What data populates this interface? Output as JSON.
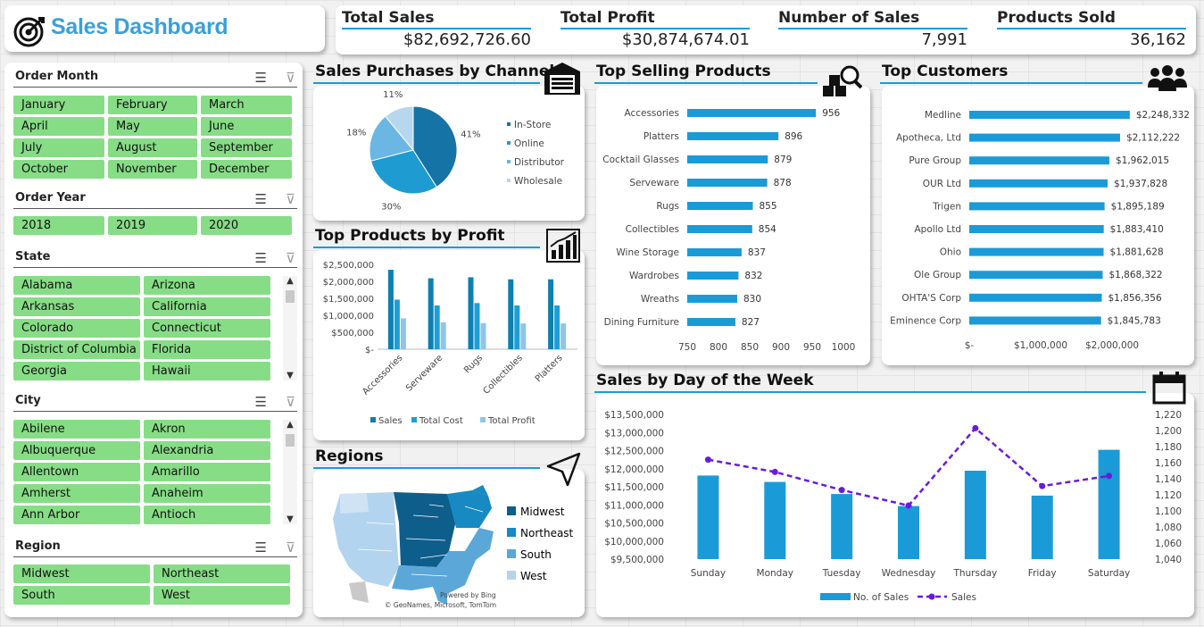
{
  "title": "Sales Dashboard",
  "kpis": [
    {
      "label": "Total Sales",
      "value": "$82,692,726.60"
    },
    {
      "label": "Total Profit",
      "value": "$30,874,674.01"
    },
    {
      "label": "Number of Sales",
      "value": "7,991"
    },
    {
      "label": "Products Sold",
      "value": "36,162"
    }
  ],
  "slicers": {
    "order_month": {
      "title": "Order Month",
      "items": [
        "January",
        "February",
        "March",
        "April",
        "May",
        "June",
        "July",
        "August",
        "September",
        "October",
        "November",
        "December"
      ]
    },
    "order_year": {
      "title": "Order Year",
      "items": [
        "2018",
        "2019",
        "2020"
      ]
    },
    "state": {
      "title": "State",
      "items": [
        "Alabama",
        "Arizona",
        "Arkansas",
        "California",
        "Colorado",
        "Connecticut",
        "District of Columbia",
        "Florida",
        "Georgia",
        "Hawaii"
      ]
    },
    "city": {
      "title": "City",
      "items": [
        "Abilene",
        "Akron",
        "Albuquerque",
        "Alexandria",
        "Allentown",
        "Amarillo",
        "Amherst",
        "Anaheim",
        "Ann Arbor",
        "Antioch"
      ]
    },
    "region": {
      "title": "Region",
      "items": [
        "Midwest",
        "Northeast",
        "South",
        "West"
      ]
    }
  },
  "panels": {
    "channel": "Sales Purchases by Channel",
    "products_profit": "Top Products by Profit",
    "regions": "Regions",
    "top_products": "Top Selling Products",
    "top_customers": "Top Customers",
    "day_of_week": "Sales by Day of the Week"
  },
  "map": {
    "legend": [
      "Midwest",
      "Northeast",
      "South",
      "West"
    ],
    "colors": [
      "#0e5e8c",
      "#1789c3",
      "#5aa7d8",
      "#b3d4ee"
    ],
    "credit1": "Powered by Bing",
    "credit2": "© GeoNames, Microsoft, TomTom"
  },
  "colors": {
    "accent": "#1a9bd7",
    "slicer_button": "#86dd86",
    "title": "#3aa0db"
  },
  "chart_data": [
    {
      "id": "channel",
      "type": "pie",
      "labels": [
        "In-Store",
        "Online",
        "Distributor",
        "Wholesale"
      ],
      "values": [
        41,
        30,
        18,
        11
      ],
      "value_labels": [
        "41%",
        "30%",
        "18%",
        "11%"
      ],
      "colors": [
        "#1673a6",
        "#1e9bd1",
        "#6bb6e2",
        "#b7d7ef"
      ],
      "legend_position": "right"
    },
    {
      "id": "products_profit",
      "type": "bar",
      "categories": [
        "Accessories",
        "Serveware",
        "Rugs",
        "Collectibles",
        "Platters"
      ],
      "series": [
        {
          "name": "Sales",
          "values": [
            2340000,
            2090000,
            2120000,
            2060000,
            2060000
          ],
          "color": "#0e7fae"
        },
        {
          "name": "Total Cost",
          "values": [
            1460000,
            1290000,
            1360000,
            1290000,
            1290000
          ],
          "color": "#1a9fd8"
        },
        {
          "name": "Total Profit",
          "values": [
            910000,
            790000,
            770000,
            760000,
            760000
          ],
          "color": "#8ec5ea"
        }
      ],
      "yticks": [
        "$-",
        "$500,000",
        "$1,000,000",
        "$1,500,000",
        "$2,000,000",
        "$2,500,000"
      ],
      "ylim": [
        0,
        2500000
      ],
      "legend_position": "bottom"
    },
    {
      "id": "top_products",
      "type": "bar",
      "orientation": "horizontal",
      "categories": [
        "Accessories",
        "Platters",
        "Cocktail Glasses",
        "Serveware",
        "Rugs",
        "Collectibles",
        "Wine Storage",
        "Wardrobes",
        "Wreaths",
        "Dining Furniture"
      ],
      "values": [
        956,
        896,
        879,
        878,
        855,
        854,
        837,
        832,
        830,
        827
      ],
      "xticks": [
        "750",
        "800",
        "850",
        "900",
        "950",
        "1000"
      ],
      "xlim": [
        750,
        1000
      ],
      "color": "#1a9bd7"
    },
    {
      "id": "top_customers",
      "type": "bar",
      "orientation": "horizontal",
      "categories": [
        "Medline",
        "Apotheca, Ltd",
        "Pure Group",
        "OUR Ltd",
        "Trigen",
        "Apollo Ltd",
        "Ohio",
        "Ole Group",
        "OHTA'S Corp",
        "Eminence Corp"
      ],
      "values": [
        2248332,
        2112222,
        1962015,
        1937828,
        1895189,
        1883410,
        1881628,
        1868322,
        1856356,
        1845783
      ],
      "value_labels": [
        "$2,248,332",
        "$2,112,222",
        "$1,962,015",
        "$1,937,828",
        "$1,895,189",
        "$1,883,410",
        "$1,881,628",
        "$1,868,322",
        "$1,856,356",
        "$1,845,783"
      ],
      "xticks": [
        "$-",
        "$1,000,000",
        "$2,000,000"
      ],
      "xlim": [
        0,
        2500000
      ],
      "color": "#1a9bd7"
    },
    {
      "id": "day_of_week",
      "type": "bar",
      "categories": [
        "Sunday",
        "Monday",
        "Tuesday",
        "Wednesday",
        "Thursday",
        "Friday",
        "Saturday"
      ],
      "series": [
        {
          "name": "No. of Sales",
          "type": "bar",
          "values": [
            1144,
            1136,
            1121,
            1106,
            1150,
            1119,
            1176
          ],
          "color": "#1a9bd7",
          "axis": "right"
        },
        {
          "name": "Sales",
          "type": "line",
          "values": [
            12250000,
            11910000,
            11410000,
            10980000,
            13120000,
            11520000,
            11800000
          ],
          "color": "#6a19e0",
          "axis": "left"
        }
      ],
      "yticks_left": [
        "$9,500,000",
        "$10,000,000",
        "$10,500,000",
        "$11,000,000",
        "$11,500,000",
        "$12,000,000",
        "$12,500,000",
        "$13,000,000",
        "$13,500,000"
      ],
      "ylim_left": [
        9500000,
        13500000
      ],
      "yticks_right": [
        "1,040",
        "1,060",
        "1,080",
        "1,100",
        "1,120",
        "1,140",
        "1,160",
        "1,180",
        "1,200",
        "1,220"
      ],
      "ylim_right": [
        1040,
        1220
      ],
      "legend_position": "bottom"
    }
  ]
}
